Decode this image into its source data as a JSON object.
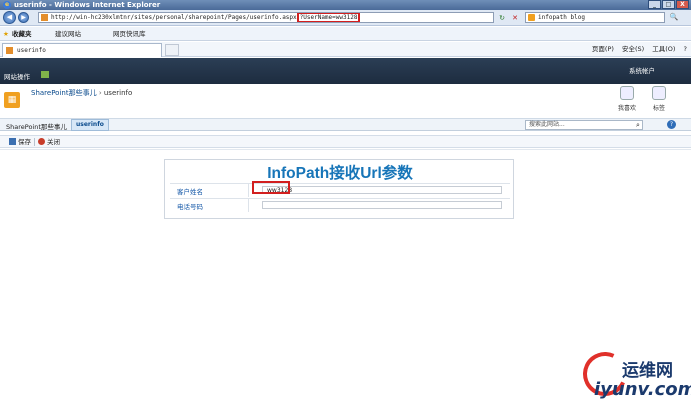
{
  "window": {
    "title": "userinfo - Windows Internet Explorer",
    "controls": [
      "_",
      "□",
      "X"
    ]
  },
  "nav": {
    "back": "◀",
    "forward": "▶",
    "address_prefix": "http://win-hc230xlmtnr/sites/personal/sharepoint/Pages/userinfo.aspx",
    "address_query": "?UserName=ww3128",
    "refresh": "↻",
    "stop": "✕",
    "search_value": "infopath blog",
    "search_go": "🔍"
  },
  "favorites": {
    "favorites_label": "收藏夹",
    "suggested_sites": "建议网站",
    "web_slice_gallery": "网页快讯库"
  },
  "tabs": {
    "active_tab": "userinfo",
    "commands": [
      "页面(P)",
      "安全(S)",
      "工具(O)",
      "?"
    ]
  },
  "sharepoint": {
    "site_actions": "网站操作",
    "user": "系统帐户",
    "breadcrumb_site": "SharePoint那些事儿",
    "breadcrumb_sep": "›",
    "breadcrumb_page": "userinfo",
    "like_it": "我喜欢",
    "tags_notes": "标签",
    "nav_home": "SharePoint那些事儿",
    "nav_current": "userinfo",
    "search_placeholder": "搜索此网站...",
    "help": "?"
  },
  "toolbar": {
    "save": "保存",
    "close": "关闭"
  },
  "form": {
    "title": "InfoPath接收Url参数",
    "customer_name_label": "客户姓名",
    "customer_name_value": "ww3128",
    "phone_label": "电话号码",
    "phone_value": ""
  },
  "watermark": {
    "line1": "运维网",
    "line2": "iyunv.com"
  },
  "colors": {
    "highlight_box": "#d21f1f",
    "form_title": "#1775b8",
    "sharepoint_top_bar": "#1d2c3f"
  }
}
